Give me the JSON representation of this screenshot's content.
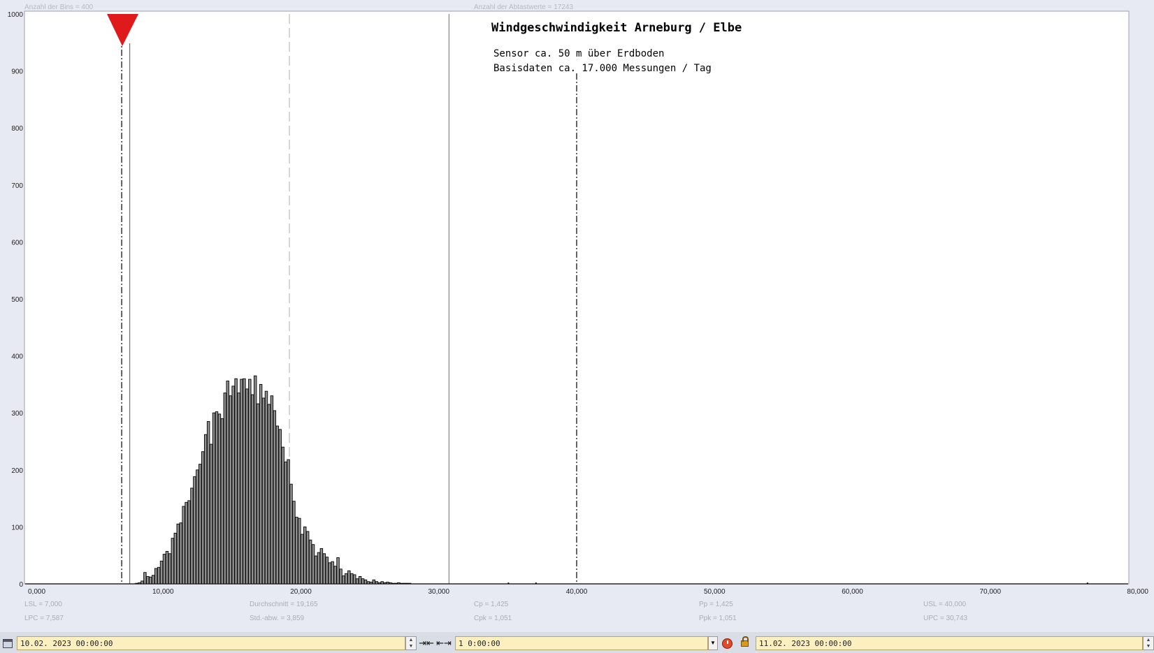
{
  "header": {
    "bins_label": "Anzahl der Bins =   400",
    "samples_label": "Anzahl der Abtastwerte = 17243"
  },
  "annotations": {
    "title": "Windgeschwindigkeit  Arneburg / Elbe",
    "line1": "Sensor ca. 50 m über Erdboden",
    "line2": "Basisdaten ca. 17.000 Messungen / Tag"
  },
  "stats": {
    "lsl": "LSL = 7,000",
    "lpc": "LPC = 7,587",
    "mean": "Durchschnitt  = 19,165",
    "std": "Std.-abw. = 3,859",
    "cp": "Cp  = 1,425",
    "cpk": "Cpk = 1,051",
    "pp": "Pp  = 1,425",
    "ppk": "Ppk = 1,051",
    "usl": "USL = 40,000",
    "upc": "UPC = 30,743"
  },
  "toolbar": {
    "start_date": "10.02. 2023   00:00:00",
    "interval": "1 0:00:00",
    "end_date": "11.02. 2023   00:00:00"
  },
  "chart_data": {
    "type": "bar",
    "xlim": [
      0,
      80000
    ],
    "ylim": [
      0,
      1000
    ],
    "x_ticks": [
      "0,000",
      "10,000",
      "20,000",
      "30,000",
      "40,000",
      "50,000",
      "60,000",
      "70,000",
      "80,000"
    ],
    "y_ticks": [
      "0",
      "100",
      "200",
      "300",
      "400",
      "500",
      "600",
      "700",
      "800",
      "900",
      "1000"
    ],
    "bin_width": 200,
    "bins_start": 8000,
    "values": [
      1,
      2,
      5,
      20,
      13,
      12,
      15,
      27,
      29,
      40,
      52,
      57,
      53,
      80,
      89,
      105,
      107,
      136,
      143,
      146,
      168,
      188,
      200,
      210,
      232,
      262,
      285,
      245,
      300,
      302,
      298,
      290,
      335,
      356,
      330,
      347,
      360,
      335,
      359,
      360,
      342,
      359,
      332,
      365,
      316,
      350,
      326,
      338,
      315,
      330,
      304,
      277,
      271,
      240,
      214,
      218,
      175,
      145,
      117,
      115,
      87,
      100,
      92,
      77,
      69,
      49,
      55,
      62,
      53,
      47,
      37,
      39,
      31,
      46,
      26,
      14,
      18,
      23,
      18,
      16,
      9,
      13,
      9,
      7,
      4,
      3,
      7,
      4,
      2,
      4,
      2,
      3,
      2,
      1,
      1,
      2,
      1,
      1,
      1,
      1
    ],
    "outliers": [
      {
        "x": 35000,
        "y": 1
      },
      {
        "x": 37000,
        "y": 1
      },
      {
        "x": 77000,
        "y": 1
      }
    ],
    "lines": {
      "lsl": 7000,
      "lpc": 7587,
      "mean": 19165,
      "upc": 30743,
      "usl": 40000
    }
  }
}
